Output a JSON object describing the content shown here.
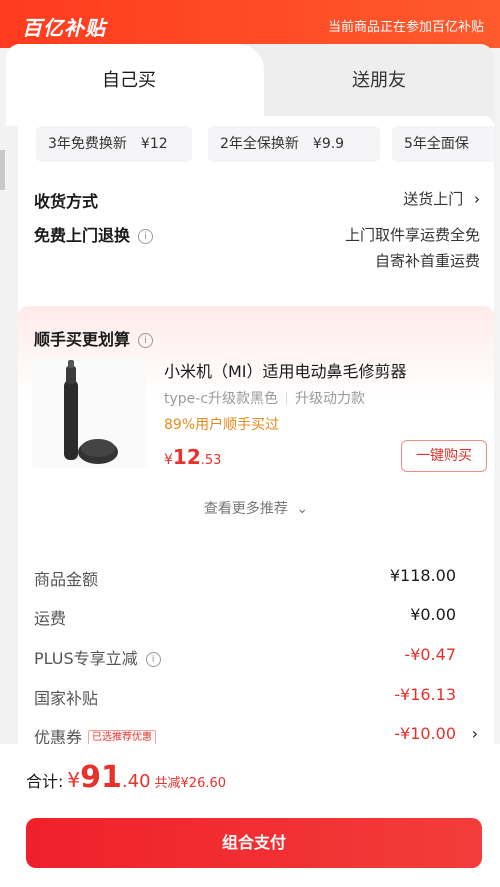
{
  "banner": {
    "logo": "百亿补贴",
    "note": "当前商品正在参加百亿补贴"
  },
  "tabs": [
    {
      "label": "自己买",
      "active": true
    },
    {
      "label": "送朋友",
      "active": false
    }
  ],
  "services": [
    {
      "name": "3年免费换新",
      "price": "¥12"
    },
    {
      "name": "2年全保换新",
      "price": "¥9.9"
    },
    {
      "name": "5年全面保",
      "price": ""
    }
  ],
  "delivery": {
    "label": "收货方式",
    "value": "送货上门"
  },
  "returns": {
    "label": "免费上门退换",
    "line1": "上门取件享运费全免",
    "line2": "自寄补首重运费"
  },
  "recommend": {
    "title": "顺手买更划算",
    "product": {
      "name": "小米机（MI）适用电动鼻毛修剪器",
      "spec1": "type-c升级款黑色",
      "spec2": "升级动力款",
      "bought": "89%用户顺手买过",
      "currency": "¥",
      "price_int": "12",
      "price_dec": ".53",
      "buy_label": "一键购买"
    },
    "more": "查看更多推荐"
  },
  "summary": {
    "rows": [
      {
        "label": "商品金额",
        "value": "¥118.00"
      },
      {
        "label": "运费",
        "value": "¥0.00"
      },
      {
        "label": "PLUS专享立减",
        "value": "-¥0.47"
      },
      {
        "label": "国家补贴",
        "value": "-¥16.13"
      },
      {
        "label": "优惠券",
        "tag": "已选推荐优惠",
        "value": "-¥10.00"
      }
    ]
  },
  "footer": {
    "total_label": "合计:",
    "currency": "¥",
    "total_int": "91",
    "total_dec": ".40",
    "saved": "共减¥26.60",
    "pay_label": "组合支付"
  },
  "colors": {
    "brand": "#ff3b1f",
    "price_red": "#e8312a",
    "bought_orange": "#e88a1a"
  }
}
